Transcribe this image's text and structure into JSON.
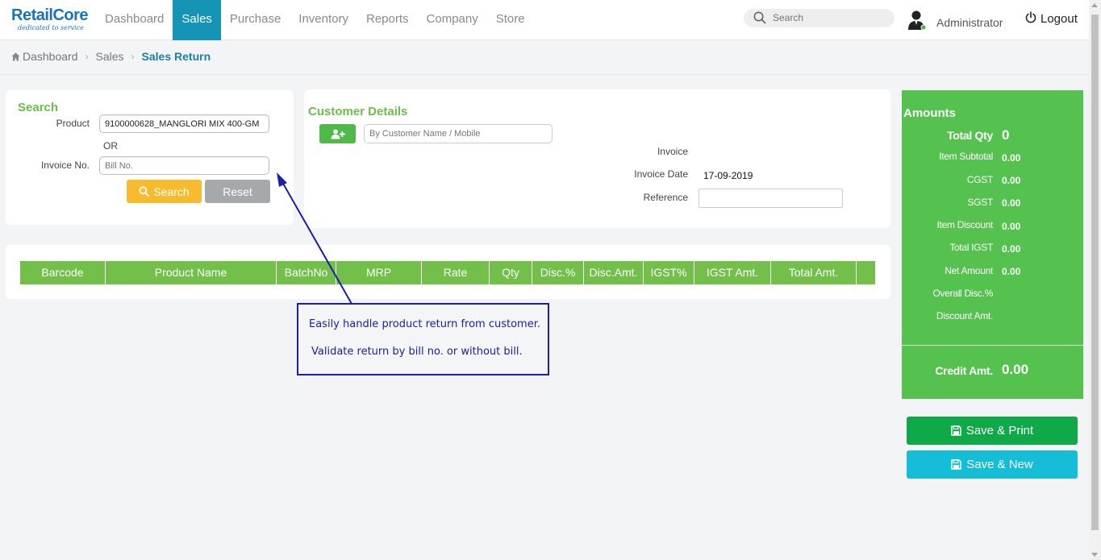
{
  "brand": {
    "name": "RetailCore",
    "tagline": "dedicated to service"
  },
  "nav": {
    "items": [
      {
        "label": "Dashboard",
        "active": false
      },
      {
        "label": "Sales",
        "active": true
      },
      {
        "label": "Purchase",
        "active": false
      },
      {
        "label": "Inventory",
        "active": false
      },
      {
        "label": "Reports",
        "active": false
      },
      {
        "label": "Company",
        "active": false
      },
      {
        "label": "Store",
        "active": false
      }
    ],
    "search_placeholder": "Search",
    "user_name": "Administrator",
    "logout_label": "Logout"
  },
  "breadcrumb": {
    "home": "Dashboard",
    "parent": "Sales",
    "current": "Sales Return"
  },
  "search_panel": {
    "title": "Search",
    "product_label": "Product",
    "product_value": "9100000628_MANGLORI MIX 400-GM",
    "or_label": "OR",
    "invoice_label": "Invoice No.",
    "invoice_placeholder": "Bill No.",
    "search_button": "Search",
    "reset_button": "Reset"
  },
  "customer": {
    "title": "Customer Details",
    "customer_placeholder": "By Customer Name / Mobile",
    "invoice_label": "Invoice",
    "invoice_value": "",
    "invoice_date_label": "Invoice Date",
    "invoice_date_value": "17-09-2019",
    "reference_label": "Reference",
    "reference_value": ""
  },
  "grid": {
    "columns": [
      "Barcode",
      "Product Name",
      "BatchNo",
      "MRP",
      "Rate",
      "Qty",
      "Disc.%",
      "Disc.Amt.",
      "IGST%",
      "IGST Amt.",
      "Total Amt.",
      ""
    ]
  },
  "annotation": {
    "line1": "Easily handle product return from customer.",
    "line2": "Validate return by bill no. or without bill."
  },
  "amounts": {
    "title": "Amounts",
    "total_qty_label": "Total Qty",
    "total_qty_value": "0",
    "rows": [
      {
        "label": "Item Subtotal",
        "value": "0.00"
      },
      {
        "label": "CGST",
        "value": "0.00"
      },
      {
        "label": "SGST",
        "value": "0.00"
      },
      {
        "label": "Item Discount",
        "value": "0.00"
      },
      {
        "label": "Total IGST",
        "value": "0.00"
      },
      {
        "label": "Net Amount",
        "value": "0.00"
      },
      {
        "label": "Overall Disc.%",
        "value": ""
      },
      {
        "label": "Discount Amt.",
        "value": ""
      }
    ],
    "credit_label": "Credit Amt.",
    "credit_value": "0.00"
  },
  "actions": {
    "save_print": "Save & Print",
    "save_new": "Save & New"
  },
  "colors": {
    "nav_active": "#1594b5",
    "accent_green": "#55c14f",
    "table_header": "#72c04a",
    "search_button": "#f8bb2e",
    "reset_button": "#a6a9ac",
    "save_print": "#10a94a",
    "save_new": "#15bdd6",
    "annotation": "#1c20a8"
  }
}
